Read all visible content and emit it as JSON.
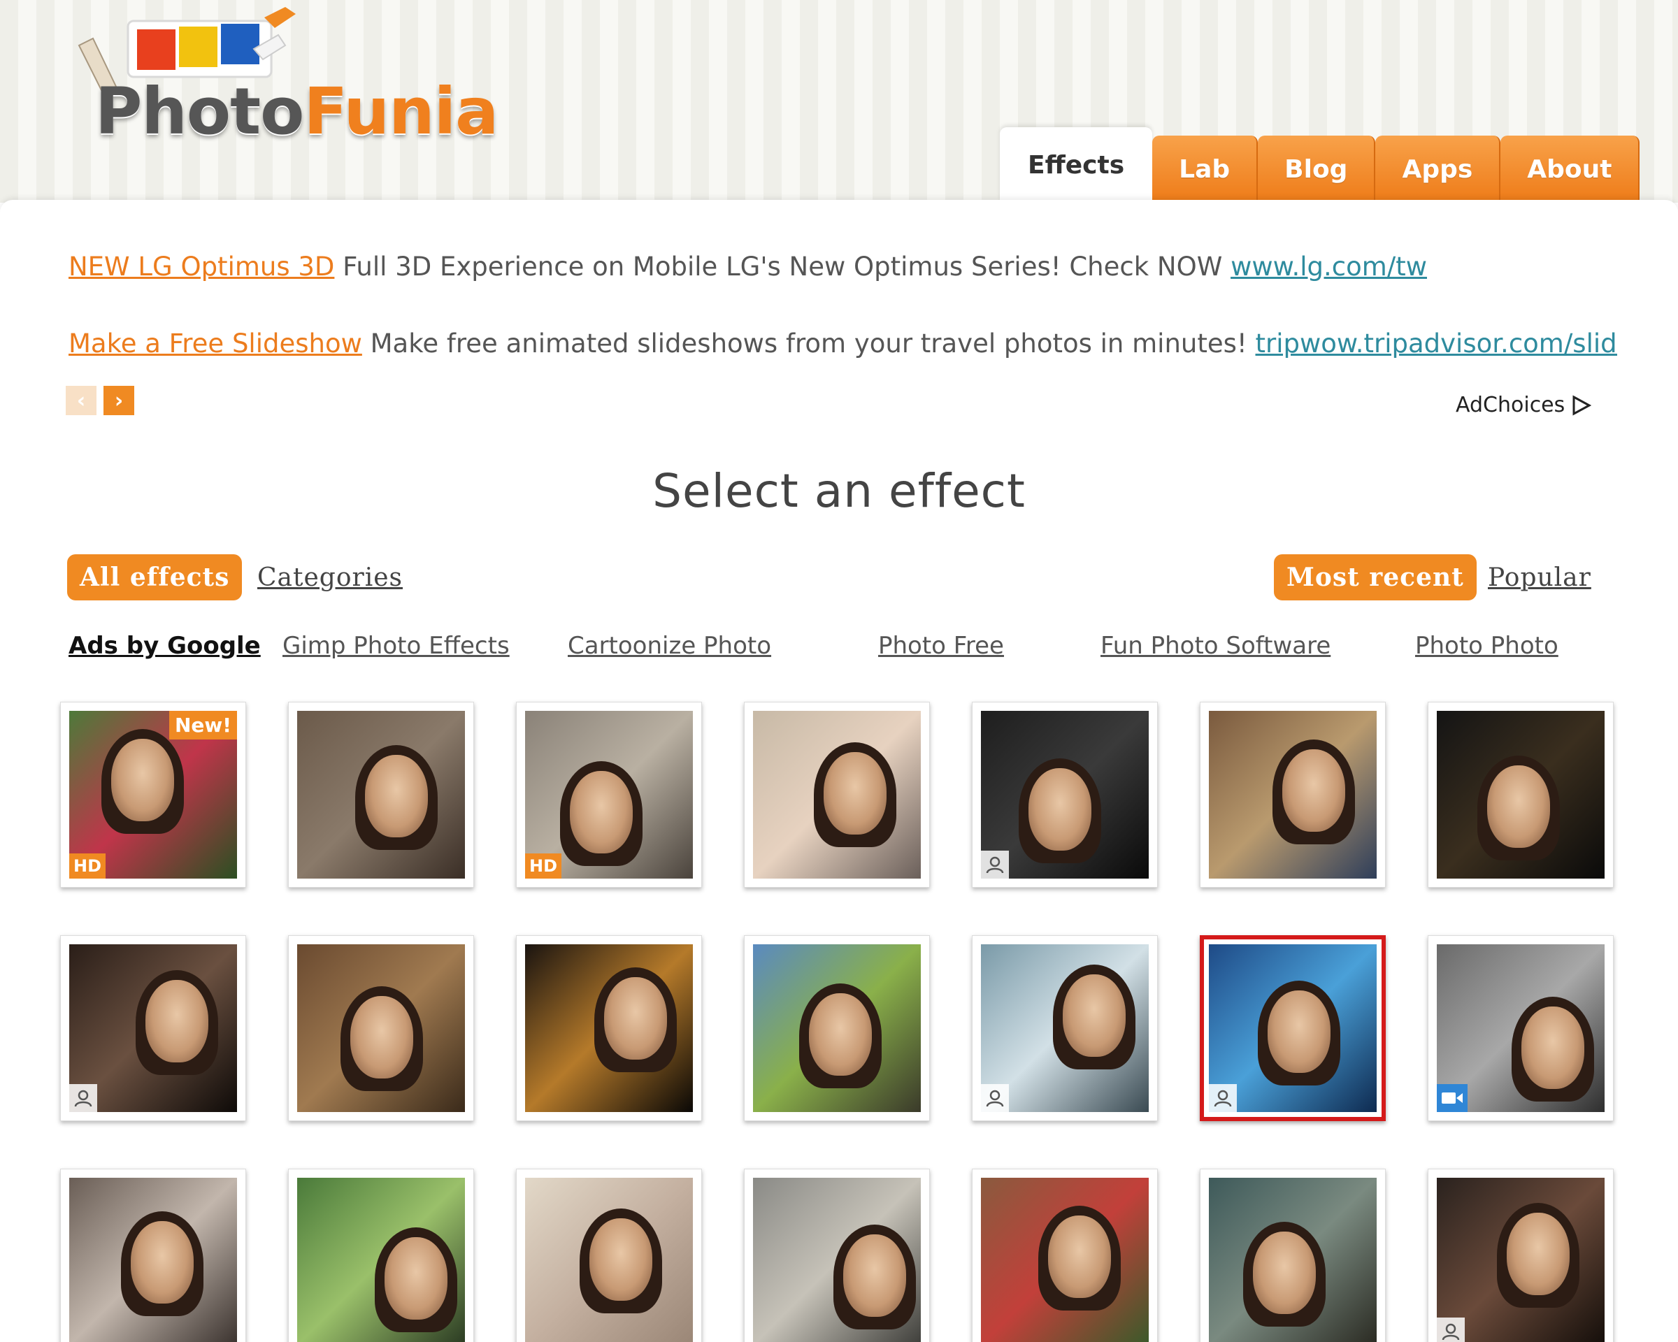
{
  "brand": {
    "name_part1": "Photo",
    "name_part2": "Funia"
  },
  "nav": {
    "tabs": [
      {
        "label": "Effects",
        "active": true
      },
      {
        "label": "Lab",
        "active": false
      },
      {
        "label": "Blog",
        "active": false
      },
      {
        "label": "Apps",
        "active": false
      },
      {
        "label": "About",
        "active": false
      }
    ]
  },
  "ads": {
    "items": [
      {
        "title": "NEW LG Optimus 3D",
        "text": " Full 3D Experience on Mobile LG's New Optimus Series! Check NOW ",
        "url": "www.lg.com/tw"
      },
      {
        "title": "Make a Free Slideshow",
        "text": " Make free animated slideshows from your travel photos in minutes! ",
        "url": "tripwow.tripadvisor.com/slidesho"
      }
    ],
    "prev_icon": "chevron-left-icon",
    "next_icon": "chevron-right-icon",
    "adchoices_label": "AdChoices"
  },
  "section": {
    "title": "Select an effect"
  },
  "filters": {
    "all_effects": "All effects",
    "categories": "Categories",
    "most_recent": "Most recent",
    "popular": "Popular"
  },
  "google_ads": {
    "label": "Ads by Google",
    "links": [
      "Gimp Photo Effects",
      "Cartoonize Photo",
      "Photo Free",
      "Fun Photo Software",
      "Photo Photo"
    ]
  },
  "effects": [
    {
      "badges": [
        "New!",
        "HD"
      ]
    },
    {
      "badges": []
    },
    {
      "badges": [
        "HD"
      ]
    },
    {
      "badges": []
    },
    {
      "badges": [
        "user"
      ]
    },
    {
      "badges": []
    },
    {
      "badges": []
    },
    {
      "badges": [
        "user"
      ]
    },
    {
      "badges": []
    },
    {
      "badges": []
    },
    {
      "badges": []
    },
    {
      "badges": [
        "user"
      ]
    },
    {
      "badges": [
        "user"
      ],
      "selected": true
    },
    {
      "badges": [
        "video"
      ]
    },
    {
      "badges": []
    },
    {
      "badges": []
    },
    {
      "badges": []
    },
    {
      "badges": []
    },
    {
      "badges": []
    },
    {
      "badges": []
    },
    {
      "badges": [
        "user"
      ]
    }
  ],
  "colors": {
    "accent": "#f08a22",
    "selected_border": "#d41a1a",
    "link_teal": "#2e8b9e"
  }
}
